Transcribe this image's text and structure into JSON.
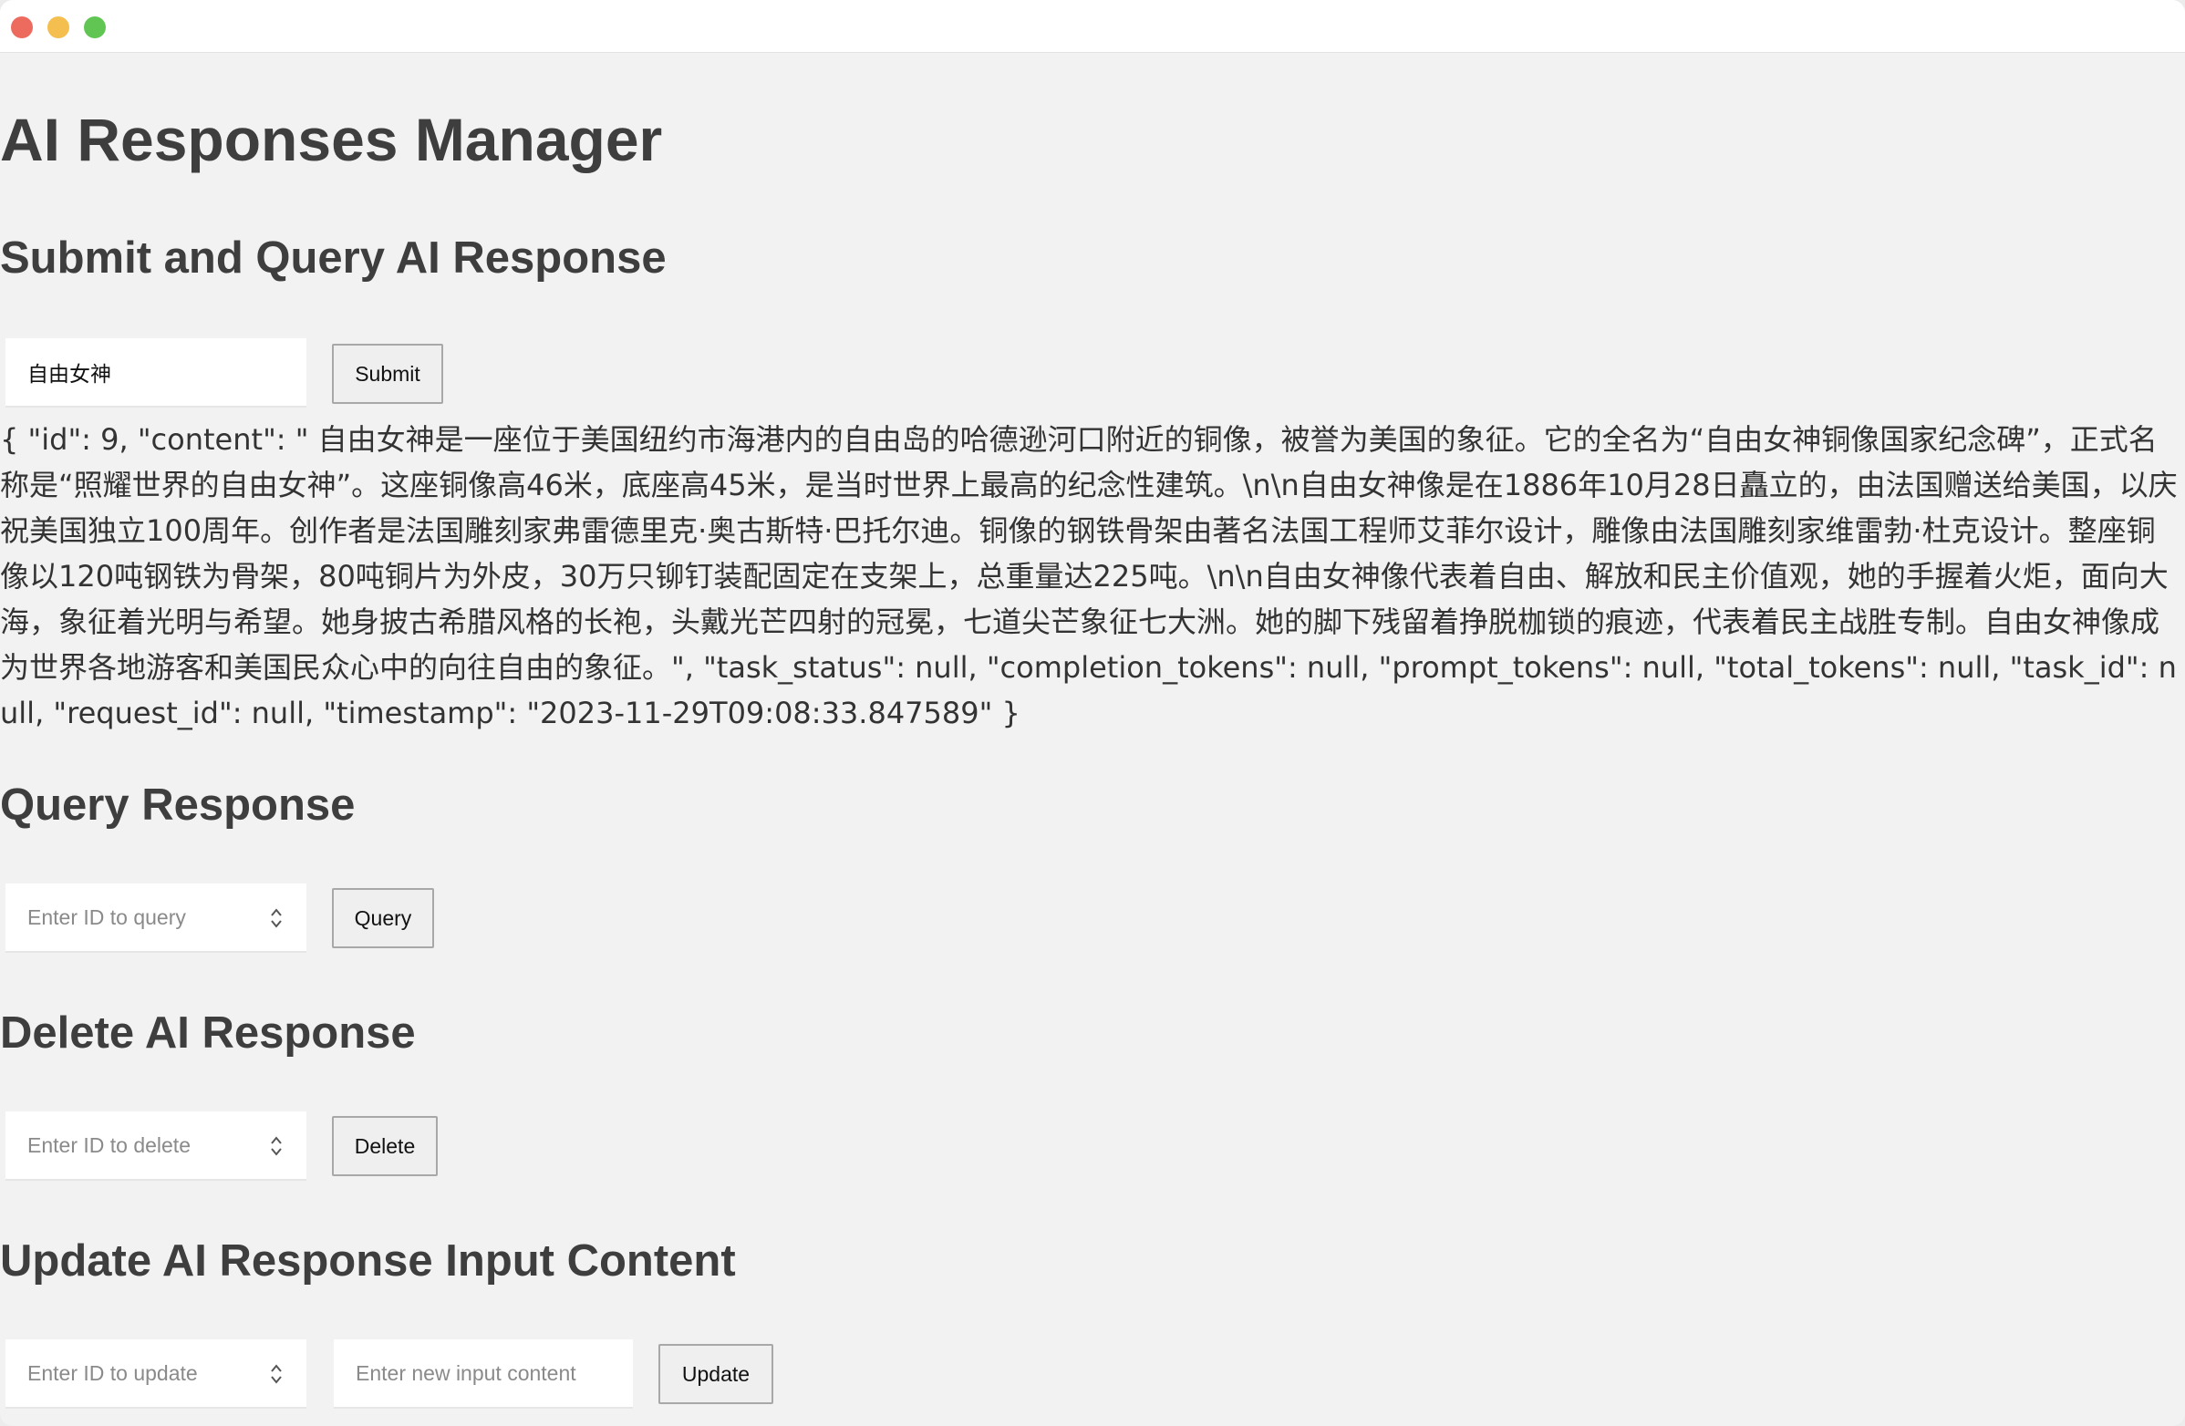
{
  "window": {
    "colors": {
      "close": "#ed6a5e",
      "minimize": "#f4bf4f",
      "maximize": "#61c554"
    }
  },
  "page": {
    "title": "AI Responses Manager"
  },
  "submit_section": {
    "heading": "Submit and Query AI Response",
    "input_value": "自由女神",
    "button_label": "Submit"
  },
  "result_text": "{ \"id\": 9, \"content\": \" 自由女神是一座位于美国纽约市海港内的自由岛的哈德逊河口附近的铜像，被誉为美国的象征。它的全名为“自由女神铜像国家纪念碑”，正式名称是“照耀世界的自由女神”。这座铜像高46米，底座高45米，是当时世界上最高的纪念性建筑。\\n\\n自由女神像是在1886年10月28日矗立的，由法国赠送给美国，以庆祝美国独立100周年。创作者是法国雕刻家弗雷德里克·奥古斯特·巴托尔迪。铜像的钢铁骨架由著名法国工程师艾菲尔设计，雕像由法国雕刻家维雷勃·杜克设计。整座铜像以120吨钢铁为骨架，80吨铜片为外皮，30万只铆钉装配固定在支架上，总重量达225吨。\\n\\n自由女神像代表着自由、解放和民主价值观，她的手握着火炬，面向大海，象征着光明与希望。她身披古希腊风格的长袍，头戴光芒四射的冠冕，七道尖芒象征七大洲。她的脚下残留着挣脱枷锁的痕迹，代表着民主战胜专制。自由女神像成为世界各地游客和美国民众心中的向往自由的象征。\", \"task_status\": null, \"completion_tokens\": null, \"prompt_tokens\": null, \"total_tokens\": null, \"task_id\": null, \"request_id\": null, \"timestamp\": \"2023-11-29T09:08:33.847589\" }",
  "query_section": {
    "heading": "Query Response",
    "input_placeholder": "Enter ID to query",
    "button_label": "Query"
  },
  "delete_section": {
    "heading": "Delete AI Response",
    "input_placeholder": "Enter ID to delete",
    "button_label": "Delete"
  },
  "update_section": {
    "heading": "Update AI Response Input Content",
    "id_placeholder": "Enter ID to update",
    "content_placeholder": "Enter new input content",
    "button_label": "Update"
  },
  "icons": {
    "stepper": "up-down-stepper-icon"
  }
}
